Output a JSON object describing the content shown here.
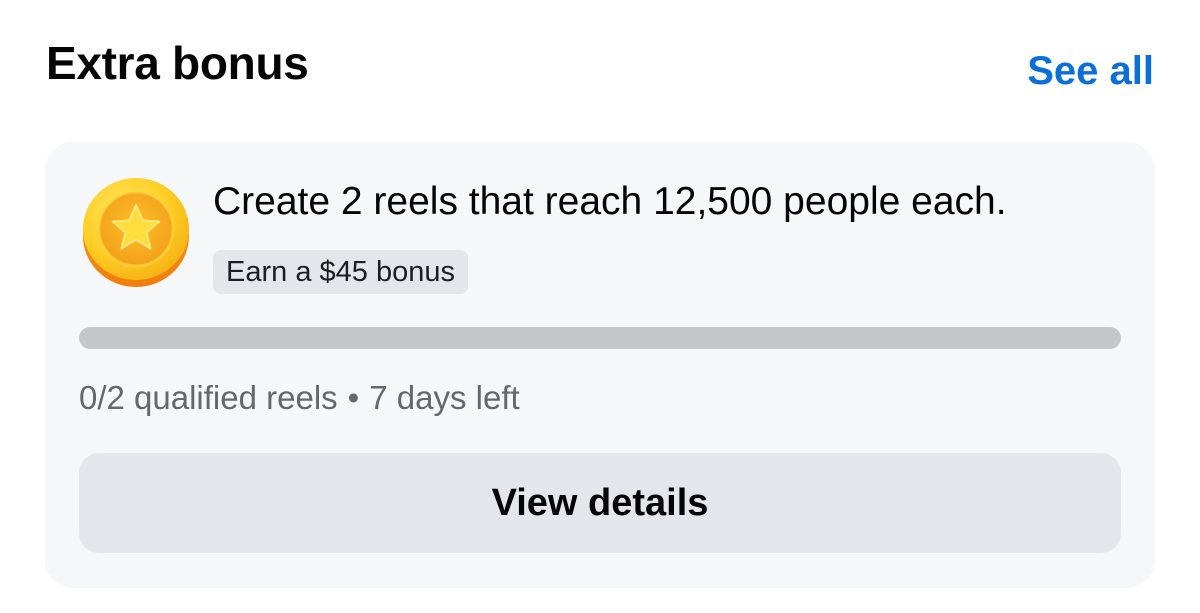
{
  "header": {
    "title": "Extra bonus",
    "see_all_label": "See all"
  },
  "bonus_card": {
    "icon": "star-coin-icon",
    "task": "Create 2 reels that reach 12,500 people each.",
    "reward": "Earn a $45 bonus",
    "progress": {
      "completed": 0,
      "total": 2,
      "fraction": 0
    },
    "status": {
      "qualified": "0/2 qualified reels",
      "separator": "•",
      "time_left": "7 days left"
    },
    "button_label": "View details"
  },
  "colors": {
    "link": "#0a6fd8",
    "card_background": "#f6f7f9",
    "chip_background": "#e4e6eb",
    "progress_track": "#c4c6ca",
    "secondary_text": "#65676b",
    "coin_gold": "#f9c41d",
    "coin_orange": "#f59a12"
  }
}
